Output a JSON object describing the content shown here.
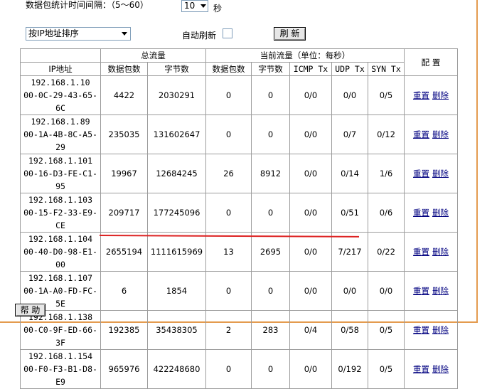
{
  "interval": {
    "label": "数据包统计时间间隔：（5～60）",
    "value": "10",
    "unit": "秒"
  },
  "sort": {
    "selected": "按IP地址排序"
  },
  "auto_refresh": {
    "label": "自动刷新"
  },
  "refresh_label": "刷 新",
  "help_label": "帮 助",
  "table": {
    "headers": {
      "ip": "IP地址",
      "total": "总流量",
      "current": "当前流量（单位：每秒）",
      "config": "配 置",
      "packets": "数据包数",
      "bytes": "字节数",
      "cur_packets": "数据包数",
      "cur_bytes": "字节数",
      "icmp": "ICMP Tx",
      "udp": "UDP Tx",
      "syn": "SYN Tx"
    },
    "reset_label": "重置",
    "delete_label": "删除",
    "rows": [
      {
        "ip": "192.168.1.10",
        "mac": "00-0C-29-43-65-6C",
        "packets": "4422",
        "bytes": "2030291",
        "cur_packets": "0",
        "cur_bytes": "0",
        "icmp": "0/0",
        "udp": "0/0",
        "syn": "0/5"
      },
      {
        "ip": "192.168.1.89",
        "mac": "00-1A-4B-8C-A5-29",
        "packets": "235035",
        "bytes": "131602647",
        "cur_packets": "0",
        "cur_bytes": "0",
        "icmp": "0/0",
        "udp": "0/7",
        "syn": "0/12"
      },
      {
        "ip": "192.168.1.101",
        "mac": "00-16-D3-FE-C1-95",
        "packets": "19967",
        "bytes": "12684245",
        "cur_packets": "26",
        "cur_bytes": "8912",
        "icmp": "0/0",
        "udp": "0/14",
        "syn": "1/6"
      },
      {
        "ip": "192.168.1.103",
        "mac": "00-15-F2-33-E9-CE",
        "packets": "209717",
        "bytes": "177245096",
        "cur_packets": "0",
        "cur_bytes": "0",
        "icmp": "0/0",
        "udp": "0/51",
        "syn": "0/6"
      },
      {
        "ip": "192.168.1.104",
        "mac": "00-40-D0-98-E1-00",
        "packets": "2655194",
        "bytes": "1111615969",
        "cur_packets": "13",
        "cur_bytes": "2695",
        "icmp": "0/0",
        "udp": "7/217",
        "syn": "0/22"
      },
      {
        "ip": "192.168.1.107",
        "mac": "00-1A-A0-FD-FC-5E",
        "packets": "6",
        "bytes": "1854",
        "cur_packets": "0",
        "cur_bytes": "0",
        "icmp": "0/0",
        "udp": "0/0",
        "syn": "0/0"
      },
      {
        "ip": "192.168.1.138",
        "mac": "00-C0-9F-ED-66-3F",
        "packets": "192385",
        "bytes": "35438305",
        "cur_packets": "2",
        "cur_bytes": "283",
        "icmp": "0/4",
        "udp": "0/58",
        "syn": "0/5"
      },
      {
        "ip": "192.168.1.154",
        "mac": "00-F0-F3-B1-D8-E9",
        "packets": "965976",
        "bytes": "422248680",
        "cur_packets": "0",
        "cur_bytes": "0",
        "icmp": "0/0",
        "udp": "0/192",
        "syn": "0/5"
      }
    ]
  },
  "colors": {
    "frame": "#e49b4f",
    "link": "#000080",
    "annotation": "#dd2222"
  }
}
